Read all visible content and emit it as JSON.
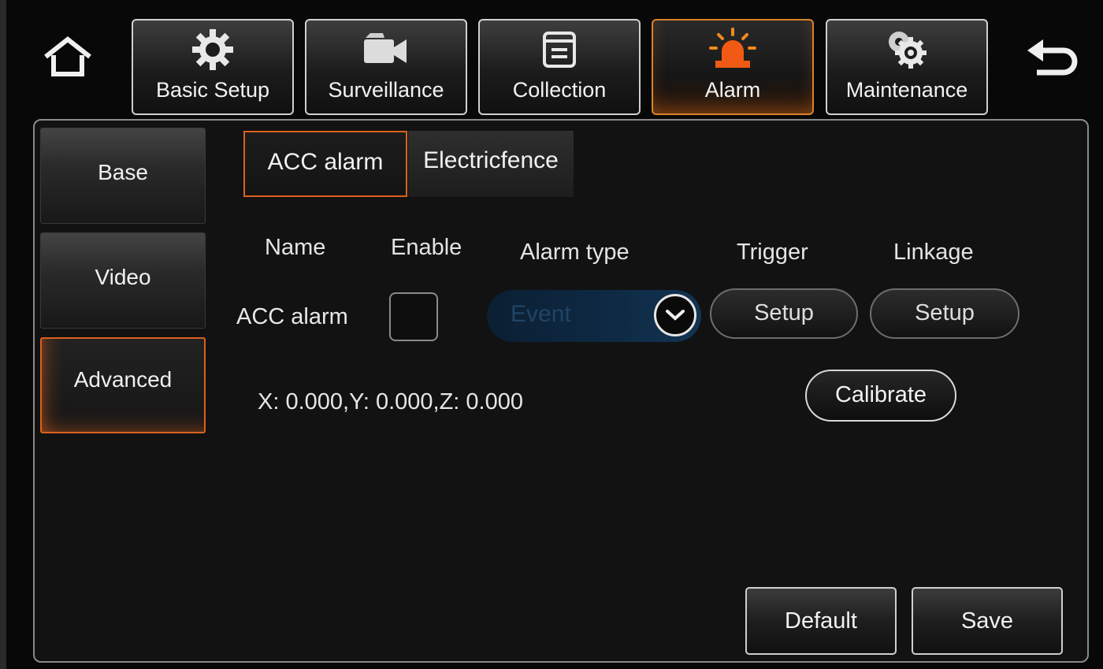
{
  "nav": {
    "tabs": [
      {
        "label": "Basic Setup",
        "icon": "gear-icon"
      },
      {
        "label": "Surveillance",
        "icon": "camera-icon"
      },
      {
        "label": "Collection",
        "icon": "document-icon"
      },
      {
        "label": "Alarm",
        "icon": "alarm-siren-icon"
      },
      {
        "label": "Maintenance",
        "icon": "gears-icon"
      }
    ],
    "active": "Alarm",
    "home_icon": "home-icon",
    "back_icon": "back-arrow-icon"
  },
  "sidebar": {
    "items": [
      {
        "label": "Base"
      },
      {
        "label": "Video"
      },
      {
        "label": "Advanced"
      }
    ],
    "active": "Advanced"
  },
  "subtabs": {
    "items": [
      {
        "label": "ACC alarm"
      },
      {
        "label": "Electricfence"
      }
    ],
    "active": "ACC alarm"
  },
  "table": {
    "headers": {
      "name": "Name",
      "enable": "Enable",
      "alarm_type": "Alarm type",
      "trigger": "Trigger",
      "linkage": "Linkage"
    },
    "row": {
      "name": "ACC alarm",
      "enabled": false,
      "alarm_type": "Event",
      "trigger_button": "Setup",
      "linkage_button": "Setup"
    }
  },
  "sensor": {
    "readout": "X: 0.000,Y: 0.000,Z: 0.000",
    "calibrate_label": "Calibrate"
  },
  "footer": {
    "default_label": "Default",
    "save_label": "Save"
  },
  "colors": {
    "accent": "#d9621e",
    "background": "#121212",
    "select_bg": "#0e2a45"
  }
}
